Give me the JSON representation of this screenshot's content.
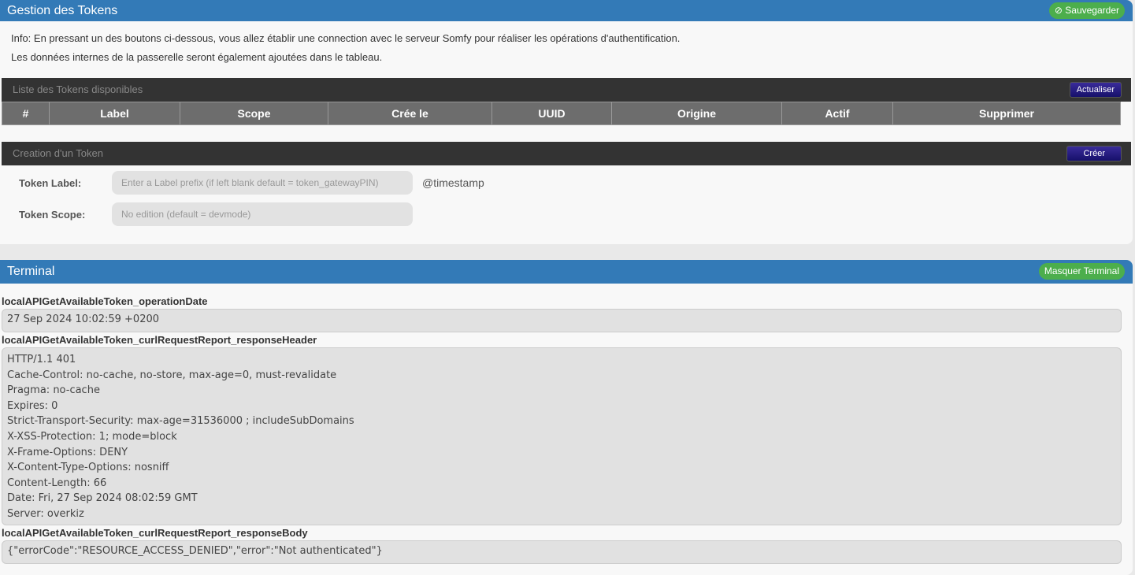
{
  "tokens": {
    "title": "Gestion des Tokens",
    "save": "Sauvegarder",
    "info": [
      "Info: En pressant un des boutons ci-dessous, vous allez établir une connection avec le serveur Somfy pour réaliser les opérations d'authentification.",
      "Les données internes de la passerelle seront également ajoutées dans le tableau."
    ],
    "list_title": "Liste des Tokens disponibles",
    "refresh": "Actualiser",
    "columns": [
      "#",
      "Label",
      "Scope",
      "Crée le",
      "UUID",
      "Origine",
      "Actif",
      "Supprimer"
    ],
    "create_title": "Creation d'un Token",
    "create": "Créer",
    "label_label": "Token Label:",
    "label_placeholder": "Enter a Label prefix (if left blank default = token_gatewayPIN)",
    "suffix": "@timestamp",
    "scope_label": "Token Scope:",
    "scope_placeholder": "No edition (default = devmode)"
  },
  "terminal": {
    "title": "Terminal",
    "hide": "Masquer Terminal",
    "fields": [
      {
        "label": "localAPIGetAvailableToken_operationDate",
        "value": "27 Sep 2024 10:02:59 +0200"
      },
      {
        "label": "localAPIGetAvailableToken_curlRequestReport_responseHeader",
        "value": "HTTP/1.1 401\nCache-Control: no-cache, no-store, max-age=0, must-revalidate\nPragma: no-cache\nExpires: 0\nStrict-Transport-Security: max-age=31536000 ; includeSubDomains\nX-XSS-Protection: 1; mode=block\nX-Frame-Options: DENY\nX-Content-Type-Options: nosniff\nContent-Length: 66\nDate: Fri, 27 Sep 2024 08:02:59 GMT\nServer: overkiz"
      },
      {
        "label": "localAPIGetAvailableToken_curlRequestReport_responseBody",
        "value": "{\"errorCode\":\"RESOURCE_ACCESS_DENIED\",\"error\":\"Not authenticated\"}"
      }
    ]
  }
}
